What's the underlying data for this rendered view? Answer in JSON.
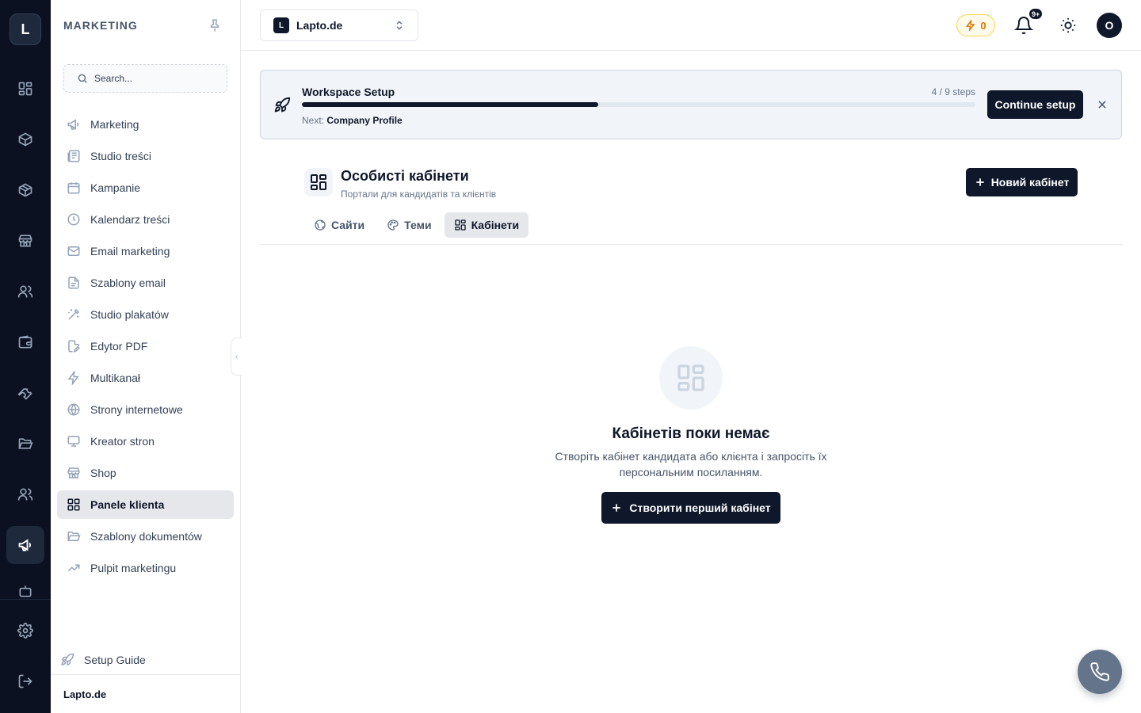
{
  "rail": {
    "logo": "L"
  },
  "sidebar": {
    "title": "MARKETING",
    "search_placeholder": "Search...",
    "items": [
      {
        "label": "Marketing",
        "icon": "megaphone-icon"
      },
      {
        "label": "Studio treści",
        "icon": "newspaper-icon"
      },
      {
        "label": "Kampanie",
        "icon": "calendar-icon"
      },
      {
        "label": "Kalendarz treści",
        "icon": "clock-icon"
      },
      {
        "label": "Email marketing",
        "icon": "mail-icon"
      },
      {
        "label": "Szablony email",
        "icon": "file-text-icon"
      },
      {
        "label": "Studio plakatów",
        "icon": "magic-wand-icon"
      },
      {
        "label": "Edytor PDF",
        "icon": "file-edit-icon"
      },
      {
        "label": "Multikanał",
        "icon": "lightning-icon"
      },
      {
        "label": "Strony internetowe",
        "icon": "globe-icon"
      },
      {
        "label": "Kreator stron",
        "icon": "monitor-icon"
      },
      {
        "label": "Shop",
        "icon": "store-icon"
      },
      {
        "label": "Panele klienta",
        "icon": "grid-icon",
        "active": true
      },
      {
        "label": "Szablony dokumentów",
        "icon": "folder-icon"
      },
      {
        "label": "Pulpit marketingu",
        "icon": "trending-up-icon"
      }
    ],
    "setup_guide": "Setup Guide",
    "footer": "Lapto.de"
  },
  "topbar": {
    "workspace_logo": "L",
    "workspace_name": "Lapto.de",
    "credits": "0",
    "notifications_badge": "9+",
    "avatar": "O"
  },
  "banner": {
    "title": "Workspace Setup",
    "steps": "4 / 9 steps",
    "progress": 0.44,
    "next_label": "Next:",
    "next_value": "Company Profile",
    "continue_label": "Continue setup"
  },
  "page": {
    "title": "Особисті кабінети",
    "subtitle": "Портали для кандидатів та клієнтів",
    "new_button": "Новий кабінет",
    "tabs": [
      {
        "label": "Сайти",
        "icon": "globe-icon"
      },
      {
        "label": "Теми",
        "icon": "palette-icon"
      },
      {
        "label": "Кабінети",
        "icon": "grid-icon",
        "active": true
      }
    ],
    "empty": {
      "title": "Кабінетів поки немає",
      "description": "Створіть кабінет кандидата або клієнта і запросіть їх персональним посиланням.",
      "create_button": "Створити перший кабінет"
    }
  },
  "colors": {
    "rail_bg": "#0b1120",
    "primary": "#0f172a",
    "credits": "#d97706",
    "fab": "#64748b"
  }
}
